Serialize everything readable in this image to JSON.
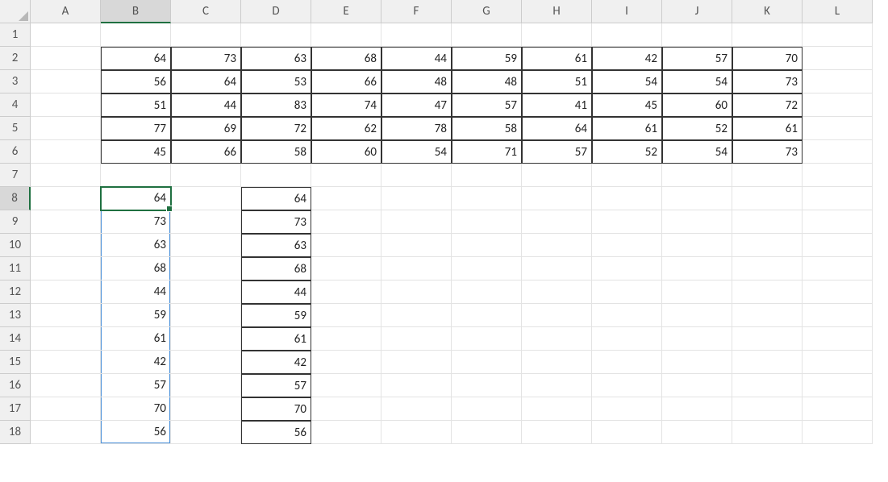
{
  "columns": [
    "A",
    "B",
    "C",
    "D",
    "E",
    "F",
    "G",
    "H",
    "I",
    "J",
    "K",
    "L"
  ],
  "rows": [
    1,
    2,
    3,
    4,
    5,
    6,
    7,
    8,
    9,
    10,
    11,
    12,
    13,
    14,
    15,
    16,
    17,
    18
  ],
  "active_cell": "B8",
  "selected_col": "B",
  "selected_row": 8,
  "table_top": {
    "range": "B2:K6",
    "data": [
      [
        64,
        73,
        63,
        68,
        44,
        59,
        61,
        42,
        57,
        70
      ],
      [
        56,
        64,
        53,
        66,
        48,
        48,
        51,
        54,
        54,
        73
      ],
      [
        51,
        44,
        83,
        74,
        47,
        57,
        41,
        45,
        60,
        72
      ],
      [
        77,
        69,
        72,
        62,
        78,
        58,
        64,
        61,
        52,
        61
      ],
      [
        45,
        66,
        58,
        60,
        54,
        71,
        57,
        52,
        54,
        73
      ]
    ]
  },
  "col_B_list": {
    "range": "B8:B18",
    "values": [
      64,
      73,
      63,
      68,
      44,
      59,
      61,
      42,
      57,
      70,
      56
    ]
  },
  "col_D_list": {
    "range": "D8:D18",
    "values": [
      64,
      73,
      63,
      68,
      44,
      59,
      61,
      42,
      57,
      70,
      56
    ]
  },
  "marquee_range": "B9:B18"
}
